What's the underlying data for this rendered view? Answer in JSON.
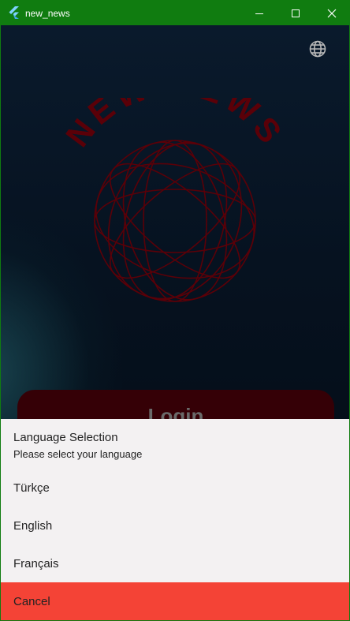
{
  "window": {
    "title": "new_news",
    "accent": "#107c10"
  },
  "app": {
    "logo_text": "NEW NEWS",
    "login_label": "Login",
    "language_icon": "globe-icon",
    "colors": {
      "logo": "#5a0008",
      "login_button": "#350006"
    }
  },
  "sheet": {
    "title": "Language Selection",
    "subtitle": "Please select your language",
    "options": [
      {
        "label": "Türkçe"
      },
      {
        "label": "English"
      },
      {
        "label": "Français"
      }
    ],
    "cancel_label": "Cancel",
    "colors": {
      "background": "#f3f1f2",
      "cancel": "#f44336"
    }
  }
}
